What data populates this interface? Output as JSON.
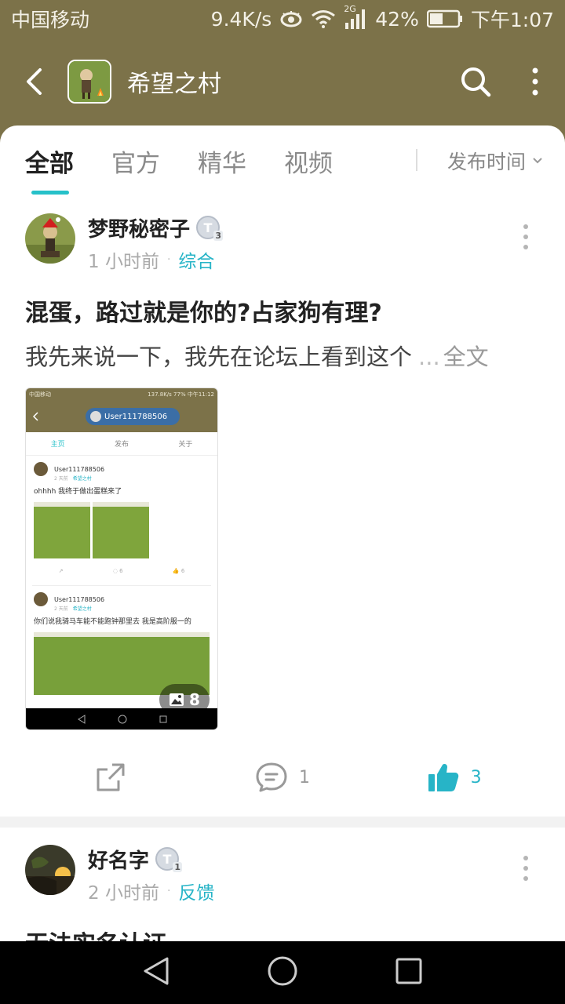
{
  "status_bar": {
    "carrier": "中国移动",
    "speed": "9.4K/s",
    "network": "2G",
    "battery": "42%",
    "time": "下午1:07"
  },
  "app_bar": {
    "title": "希望之村",
    "icons": [
      "back-arrow-icon",
      "search-icon",
      "more-vertical-icon"
    ]
  },
  "tabs": [
    {
      "label": "全部",
      "active": true
    },
    {
      "label": "官方",
      "active": false
    },
    {
      "label": "精华",
      "active": false
    },
    {
      "label": "视频",
      "active": false
    }
  ],
  "sort": {
    "label": "发布时间"
  },
  "posts": [
    {
      "author": "梦野秘密子",
      "level": "T",
      "level_num": "3",
      "time": "1 小时前",
      "category": "综合",
      "title": "混蛋，路过就是你的?占家狗有理?",
      "excerpt": "我先来说一下，我先在论坛上看到这个",
      "ellipsis": "...",
      "full_text_label": "全文",
      "thumbnail": {
        "status_left": "中国移动",
        "status_right": "137.8K/s 77% 中午11:12",
        "user": "User111788506",
        "tabs": [
          "主页",
          "发布",
          "关于"
        ],
        "items": [
          {
            "name": "User111788506",
            "time": "2 天前",
            "category": "希望之村",
            "text": "ohhhh 我终于做出蛋糕来了",
            "comments": "6",
            "likes": "6"
          },
          {
            "name": "User111788506",
            "time": "2 天前",
            "category": "希望之村",
            "text": "你们说我骑马车能不能跑钟那里去 我是高阶服一的"
          }
        ]
      },
      "image_count": "8",
      "comments": "1",
      "likes": "3"
    },
    {
      "author": "好名字",
      "level": "T",
      "level_num": "1",
      "time": "2 小时前",
      "category": "反馈",
      "title": "无法实名认证"
    }
  ],
  "colors": {
    "header": "#7c7249",
    "accent": "#26c1c9",
    "category": "#27b4c7"
  }
}
